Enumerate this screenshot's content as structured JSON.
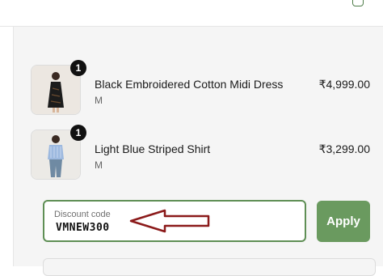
{
  "order_summary": {
    "items": [
      {
        "quantity": "1",
        "name": "Black Embroidered Cotton Midi Dress",
        "variant": "M",
        "price": "₹4,999.00",
        "image": "black-midi-dress-photo"
      },
      {
        "quantity": "1",
        "name": "Light Blue Striped Shirt",
        "variant": "M",
        "price": "₹3,299.00",
        "image": "light-blue-shirt-photo"
      }
    ]
  },
  "discount": {
    "label": "Discount code",
    "value": "VMNEW300",
    "apply_label": "Apply"
  },
  "colors": {
    "accent": "#6a9a5f",
    "arrow": "#8b1a1a"
  }
}
